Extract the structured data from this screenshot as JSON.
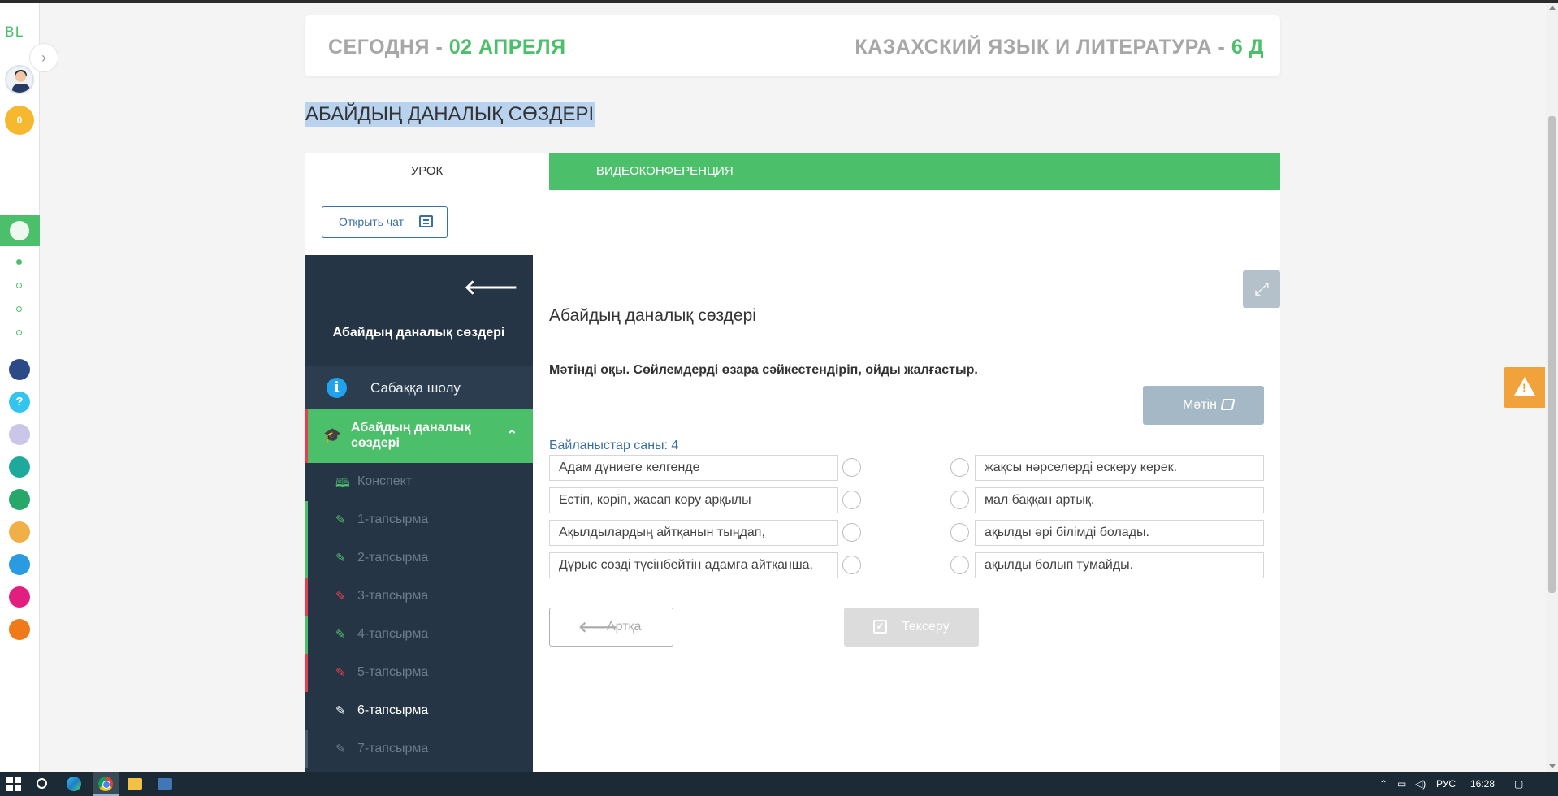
{
  "rail": {
    "logo": "BL",
    "coins": "0",
    "apps": [
      "smart-nation",
      "help",
      "keyboard",
      "bilim-class",
      "bilim-land",
      "bilim-media",
      "checklist",
      "twig",
      "mektep"
    ]
  },
  "header": {
    "today_label": "СЕГОДНЯ - ",
    "date": "02 АПРЕЛЯ",
    "subject_label": "КАЗАХСКИЙ ЯЗЫК И ЛИТЕРАТУРА - ",
    "class": "6 Д"
  },
  "lesson_title": "АБАЙДЫҢ ДАНАЛЫҚ СӨЗДЕРІ",
  "tabs": {
    "lesson": "УРОК",
    "video": "ВИДЕОКОНФЕРЕНЦИЯ"
  },
  "chat_button": "Открыть чат",
  "sidebar": {
    "title": "Абайдың даналық сөздері",
    "overview": "Сабаққа шолу",
    "active_section": "Абайдың даналық сөздері",
    "items": [
      {
        "label": "Конспект"
      },
      {
        "label": "1-тапсырма"
      },
      {
        "label": "2-тапсырма"
      },
      {
        "label": "3-тапсырма"
      },
      {
        "label": "4-тапсырма"
      },
      {
        "label": "5-тапсырма"
      },
      {
        "label": "6-тапсырма"
      },
      {
        "label": "7-тапсырма"
      }
    ]
  },
  "task": {
    "title": "Абайдың даналық сөздері",
    "instruction": "Мәтінді оқы. Сөйлемдерді өзара сәйкестендіріп, ойды жалғастыр.",
    "text_button": "Мәтін",
    "connections_label": "Байланыстар саны: 4",
    "left_items": [
      "Адам дүниеге келгенде",
      "Естіп, көріп, жасап көру арқылы",
      "Ақылдылардың айтқанын тыңдап,",
      "Дұрыс сөзді түсінбейтін адамға айтқанша,"
    ],
    "right_items": [
      "жақсы нәрселерді ескеру керек.",
      "мал баққан артық.",
      "ақылды әрі білімді болады.",
      "ақылды болып тумайды."
    ],
    "back_button": "Артқа",
    "check_button": "Тексеру"
  },
  "taskbar": {
    "language": "РУС",
    "time": "16:28"
  },
  "colors": {
    "accent_green": "#4cbf6a",
    "sidebar_dark": "#263546",
    "highlight_red": "#e53e4f",
    "link_blue": "#3b6fa3",
    "warning_orange": "#f2a23a"
  }
}
